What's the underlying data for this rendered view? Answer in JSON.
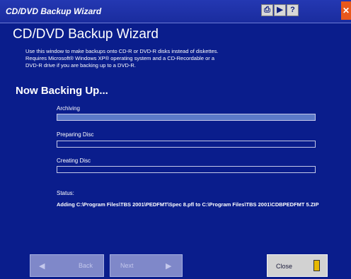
{
  "window": {
    "title": "CD/DVD Backup Wizard"
  },
  "header": {
    "title": "CD/DVD Backup Wizard",
    "description": "Use this window to make backups onto CD-R or DVD-R disks instead of diskettes.\nRequires Microsoft® Windows XP® operating system and a CD-Recordable or a\nDVD-R drive if you are backing up to a DVD-R."
  },
  "progress": {
    "heading": "Now Backing Up...",
    "stages": [
      {
        "label": "Archiving",
        "fraction": 1.0
      },
      {
        "label": "Preparing Disc",
        "fraction": 0.0
      },
      {
        "label": "Creating Disc",
        "fraction": 0.0
      }
    ]
  },
  "status": {
    "label": "Status:",
    "text": "Adding C:\\Program Files\\TBS 2001\\PEDFMT\\Spec 8.pfl to C:\\Program Files\\TBS 2001\\CDBPEDFMT 5.ZIP"
  },
  "buttons": {
    "back": "Back",
    "next": "Next",
    "close": "Close"
  },
  "colors": {
    "background": "#0a1d8c",
    "progress_fill": "#5b79c8",
    "close_button": "#e8581c"
  }
}
